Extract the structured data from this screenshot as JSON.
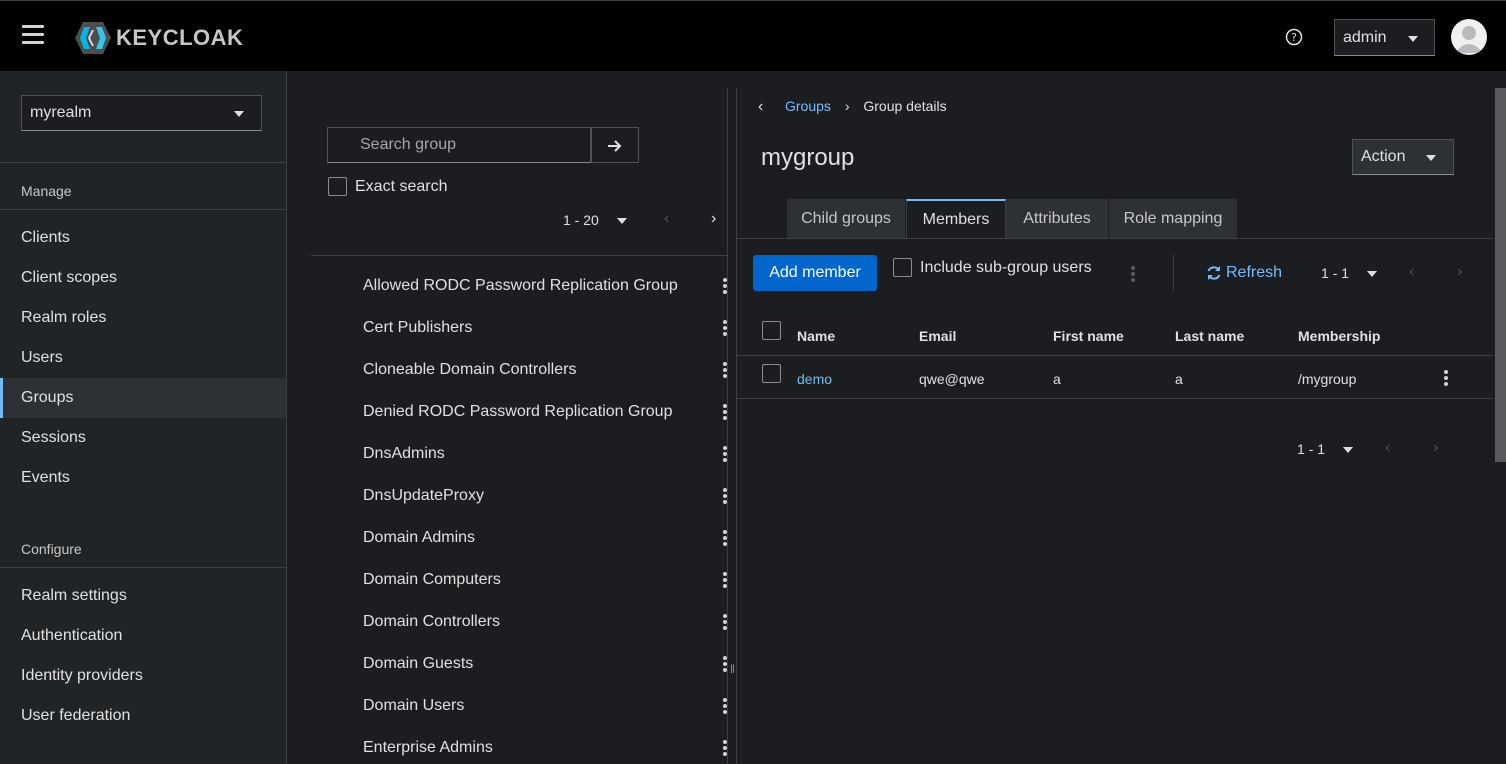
{
  "header": {
    "brand": "KEYCLOAK",
    "user_label": "admin"
  },
  "sidebar": {
    "realm": "myrealm",
    "manage_heading": "Manage",
    "manage_items": [
      "Clients",
      "Client scopes",
      "Realm roles",
      "Users",
      "Groups",
      "Sessions",
      "Events"
    ],
    "active_item": "Groups",
    "configure_heading": "Configure",
    "configure_items": [
      "Realm settings",
      "Authentication",
      "Identity providers",
      "User federation"
    ]
  },
  "groups_panel": {
    "search_placeholder": "Search group",
    "exact_search_label": "Exact search",
    "pagination": "1 - 20",
    "groups": [
      "Allowed RODC Password Replication Group",
      "Cert Publishers",
      "Cloneable Domain Controllers",
      "Denied RODC Password Replication Group",
      "DnsAdmins",
      "DnsUpdateProxy",
      "Domain Admins",
      "Domain Computers",
      "Domain Controllers",
      "Domain Guests",
      "Domain Users",
      "Enterprise Admins"
    ]
  },
  "main": {
    "breadcrumb_parent": "Groups",
    "breadcrumb_current": "Group details",
    "title": "mygroup",
    "action_label": "Action",
    "tabs": [
      "Child groups",
      "Members",
      "Attributes",
      "Role mapping"
    ],
    "active_tab": "Members",
    "add_member_label": "Add member",
    "include_subgroup_label": "Include sub-group users",
    "refresh_label": "Refresh",
    "pagination_top": "1 - 1",
    "pagination_bottom": "1 - 1",
    "table": {
      "columns": [
        "Name",
        "Email",
        "First name",
        "Last name",
        "Membership"
      ],
      "rows": [
        {
          "name": "demo",
          "email": "qwe@qwe",
          "first_name": "a",
          "last_name": "a",
          "membership": "/mygroup"
        }
      ]
    }
  },
  "colors": {
    "accent": "#73bcf7",
    "primary_button": "#0066cc",
    "background": "#1b1d21",
    "masthead": "#000000"
  }
}
